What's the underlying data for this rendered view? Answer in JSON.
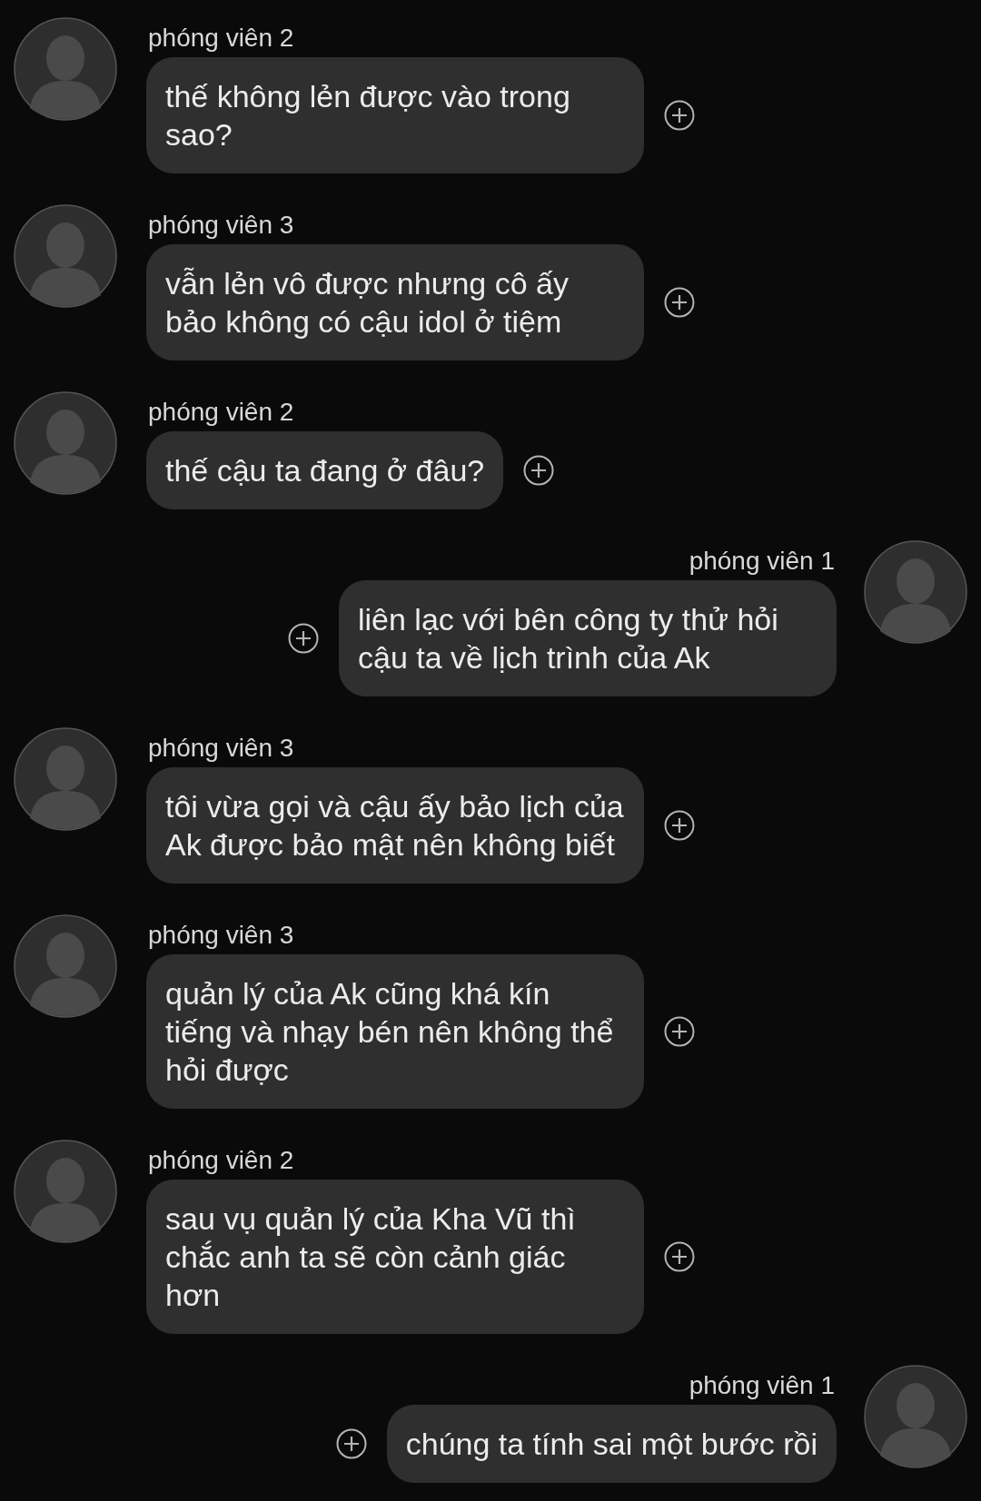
{
  "messages": [
    {
      "sender": "phóng viên 2",
      "text": "thế không lẻn được vào trong sao?",
      "kind": "incoming"
    },
    {
      "sender": "phóng viên 3",
      "text": "vẫn lẻn vô được nhưng cô ấy bảo không có cậu idol ở tiệm",
      "kind": "incoming"
    },
    {
      "sender": "phóng viên 2",
      "text": "thế cậu ta đang ở đâu?",
      "kind": "incoming"
    },
    {
      "sender": "phóng viên 1",
      "text": "liên lạc với bên công ty thử hỏi cậu ta về lịch trình của Ak",
      "kind": "outgoing"
    },
    {
      "sender": "phóng viên 3",
      "text": "tôi vừa gọi và cậu ấy bảo lịch của Ak được bảo mật nên không biết",
      "kind": "incoming"
    },
    {
      "sender": "phóng viên 3",
      "text": "quản lý của Ak cũng khá kín tiếng và nhạy bén nên không thể hỏi được",
      "kind": "incoming"
    },
    {
      "sender": "phóng viên 2",
      "text": "sau vụ quản lý của Kha Vũ thì chắc anh ta sẽ còn cảnh giác hơn",
      "kind": "incoming"
    },
    {
      "sender": "phóng viên 1",
      "text": "chúng ta tính sai một bước rồi",
      "kind": "outgoing"
    }
  ]
}
